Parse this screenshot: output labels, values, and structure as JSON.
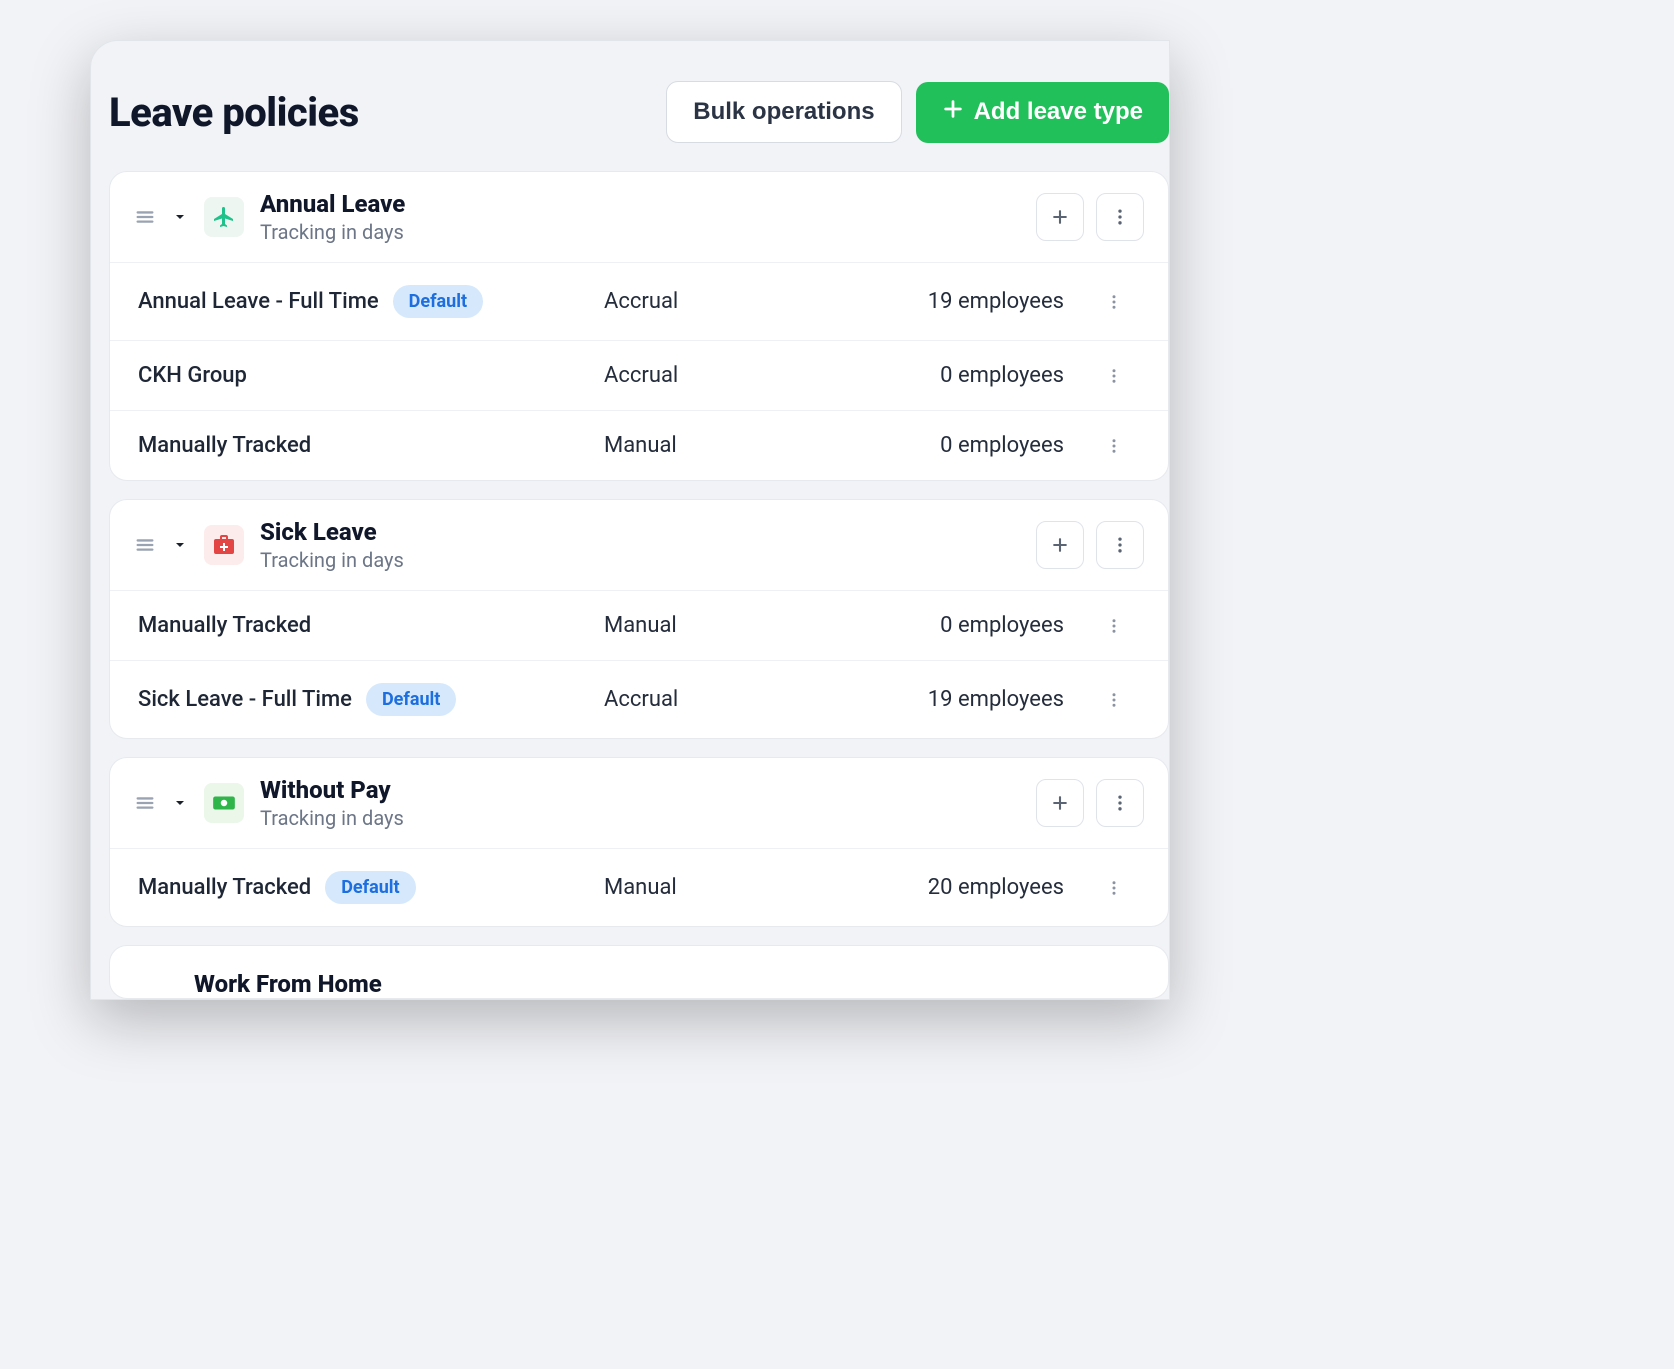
{
  "header": {
    "title": "Leave policies",
    "bulk_button": "Bulk operations",
    "add_button": "Add leave type"
  },
  "badge_default": "Default",
  "leave_types": [
    {
      "title": "Annual Leave",
      "subtitle": "Tracking in days",
      "icon": "airplane",
      "policies": [
        {
          "name": "Annual Leave - Full Time",
          "default": true,
          "mode": "Accrual",
          "count": "19 employees"
        },
        {
          "name": "CKH Group",
          "default": false,
          "mode": "Accrual",
          "count": "0 employees"
        },
        {
          "name": "Manually Tracked",
          "default": false,
          "mode": "Manual",
          "count": "0 employees"
        }
      ]
    },
    {
      "title": "Sick Leave",
      "subtitle": "Tracking in days",
      "icon": "medkit",
      "policies": [
        {
          "name": "Manually Tracked",
          "default": false,
          "mode": "Manual",
          "count": "0 employees"
        },
        {
          "name": "Sick Leave - Full Time",
          "default": true,
          "mode": "Accrual",
          "count": "19 employees"
        }
      ]
    },
    {
      "title": "Without Pay",
      "subtitle": "Tracking in days",
      "icon": "cash",
      "policies": [
        {
          "name": "Manually Tracked",
          "default": true,
          "mode": "Manual",
          "count": "20 employees"
        }
      ]
    },
    {
      "title": "Work From Home",
      "subtitle": "",
      "icon": "",
      "policies": []
    }
  ]
}
